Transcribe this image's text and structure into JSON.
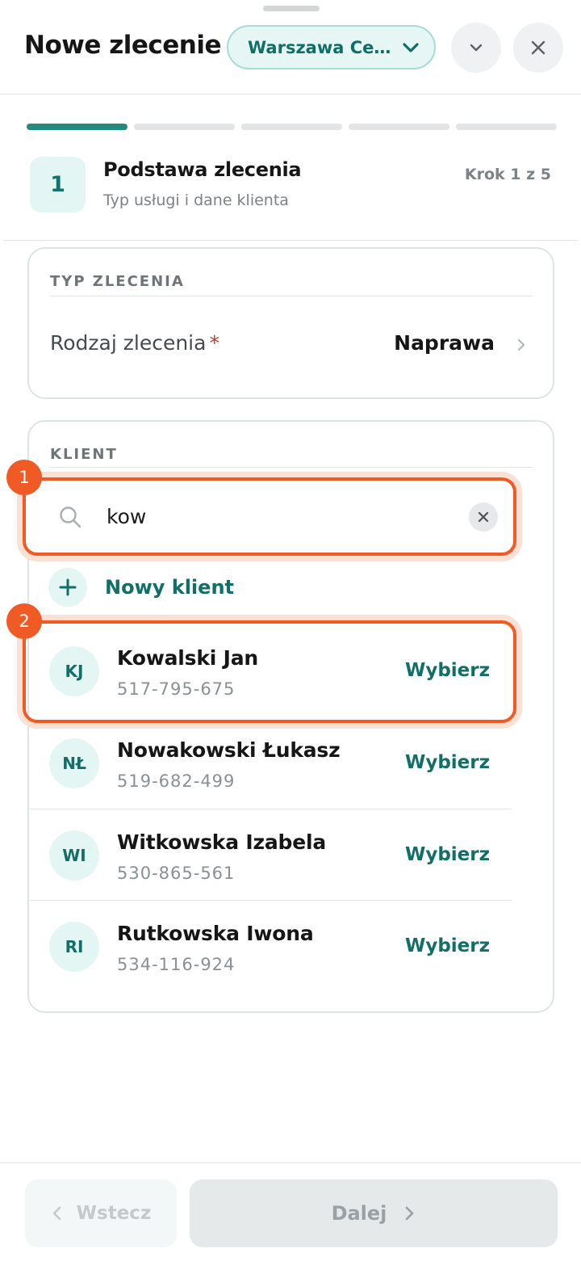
{
  "header": {
    "title": "Nowe zlecenie",
    "location": "Warszawa Ce…"
  },
  "progress": {
    "current_step": 1,
    "total_steps": 5
  },
  "step": {
    "number": "1",
    "title": "Podstawa zlecenia",
    "subtitle": "Typ usługi i dane klienta",
    "counter": "Krok 1 z 5"
  },
  "order_type": {
    "section_label": "TYP ZLECENIA",
    "field_label": "Rodzaj zlecenia",
    "required_mark": "*",
    "value": "Naprawa"
  },
  "client": {
    "section_label": "KLIENT",
    "search_value": "kow",
    "new_client_label": "Nowy klient",
    "results": [
      {
        "initials": "KJ",
        "name": "Kowalski Jan",
        "phone": "517-795-675",
        "action": "Wybierz"
      },
      {
        "initials": "NŁ",
        "name": "Nowakowski Łukasz",
        "phone": "519-682-499",
        "action": "Wybierz"
      },
      {
        "initials": "WI",
        "name": "Witkowska Izabela",
        "phone": "530-865-561",
        "action": "Wybierz"
      },
      {
        "initials": "RI",
        "name": "Rutkowska Iwona",
        "phone": "534-116-924",
        "action": "Wybierz"
      }
    ]
  },
  "annotations": {
    "badge_1": "1",
    "badge_2": "2"
  },
  "footer": {
    "back_label": "Wstecz",
    "next_label": "Dalej"
  },
  "colors": {
    "accent": "#116f67",
    "highlight": "#f05a24"
  }
}
